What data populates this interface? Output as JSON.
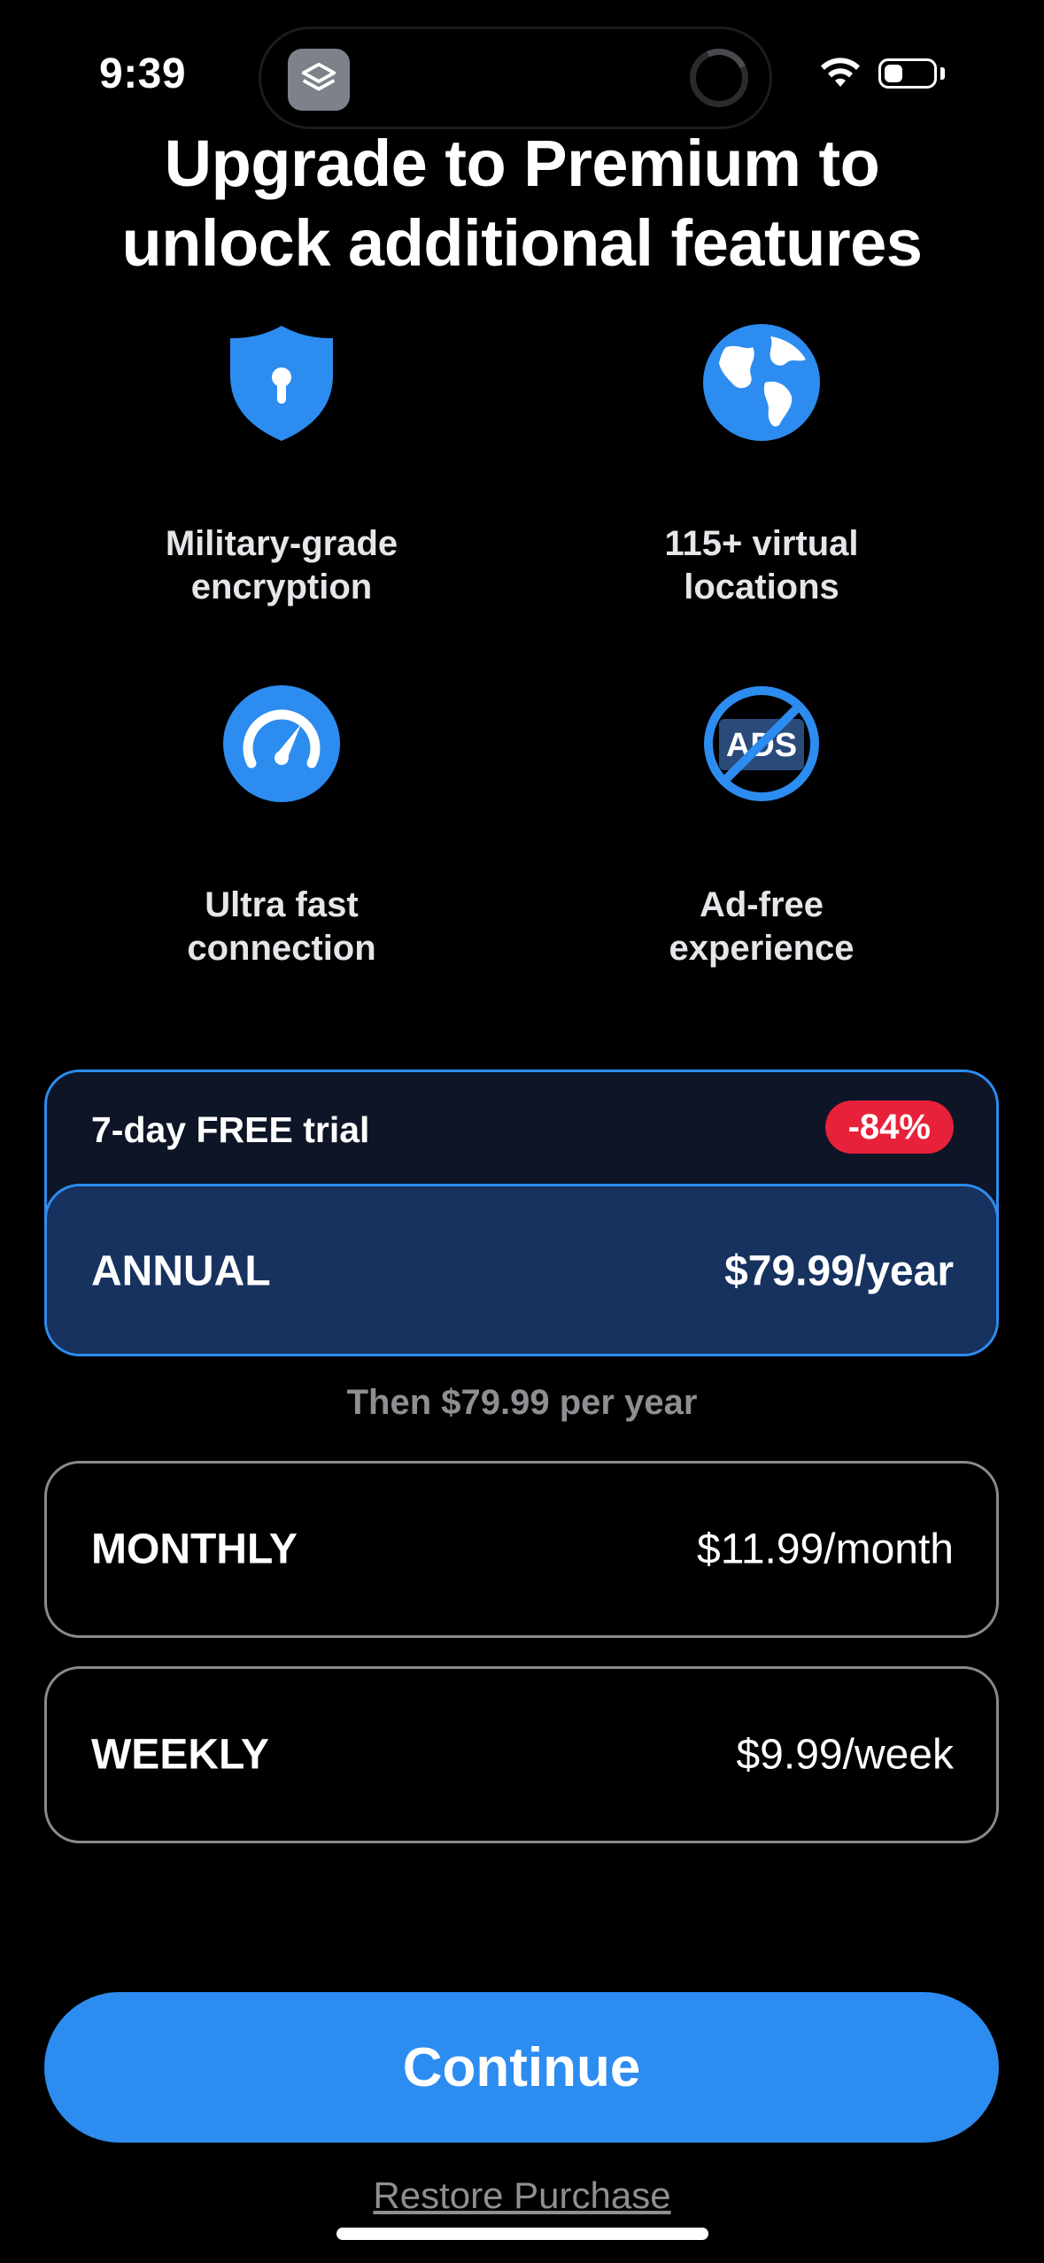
{
  "status_bar": {
    "time": "9:39",
    "island_app_icon": "stack-layers-icon",
    "wifi_icon": "wifi-icon",
    "battery_icon": "battery-icon",
    "battery_level": 0.25
  },
  "header": {
    "title_line1": "Upgrade to Premium to",
    "title_line2": "unlock additional features"
  },
  "features": [
    {
      "icon": "shield-lock-icon",
      "line1": "Military-grade",
      "line2": "encryption"
    },
    {
      "icon": "globe-icon",
      "line1": "115+ virtual",
      "line2": "locations"
    },
    {
      "icon": "speedometer-icon",
      "line1": "Ultra fast",
      "line2": "connection"
    },
    {
      "icon": "no-ads-icon",
      "ads_text": "ADS",
      "line1": "Ad-free",
      "line2": "experience"
    }
  ],
  "plans": {
    "annual": {
      "trial_label": "7-day FREE trial",
      "discount": "-84%",
      "name": "ANNUAL",
      "price": "$79.99/year",
      "selected": true
    },
    "annual_note": "Then $79.99 per year",
    "monthly": {
      "name": "MONTHLY",
      "price": "$11.99/month"
    },
    "weekly": {
      "name": "WEEKLY",
      "price": "$9.99/week"
    }
  },
  "actions": {
    "continue_label": "Continue",
    "restore_label": "Restore Purchase"
  },
  "colors": {
    "accent": "#2d8cf0",
    "selected_bg": "#17325f",
    "discount_badge": "#e8213a",
    "background": "#000000"
  }
}
